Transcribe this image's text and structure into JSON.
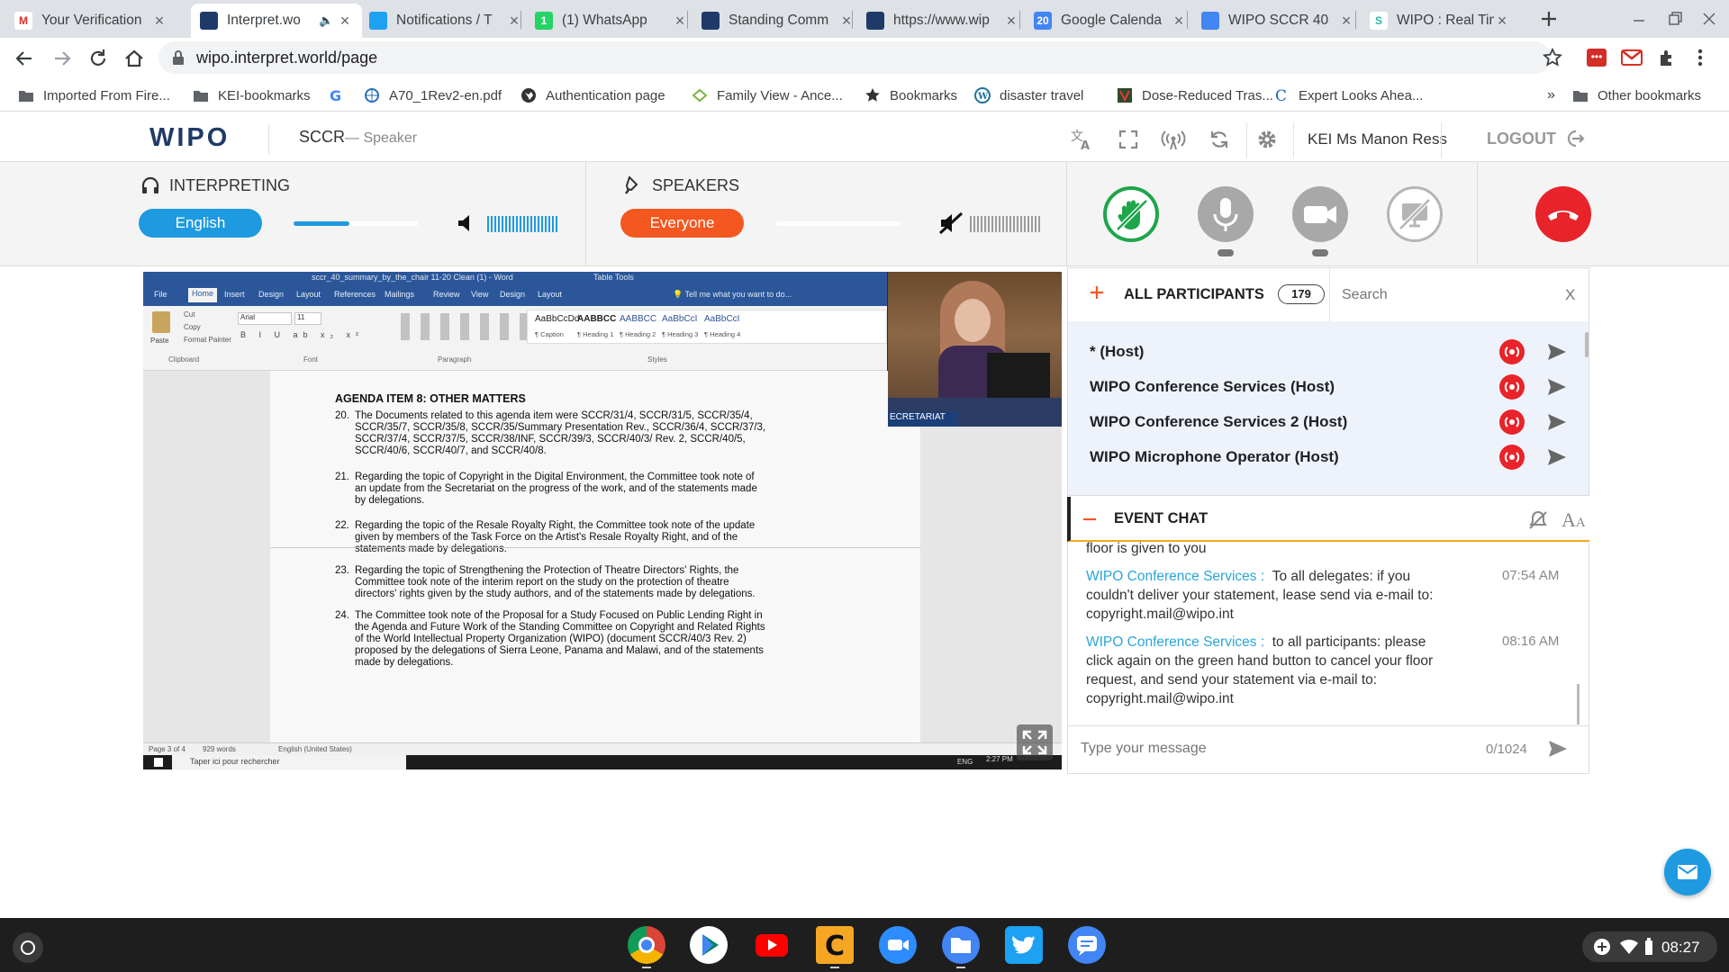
{
  "tabs": [
    {
      "title": "Your Verification",
      "fav_bg": "#ffffff",
      "fav_txt": "M",
      "fav_color": "#d93025",
      "active": false
    },
    {
      "title": "Interpret.wo",
      "fav_bg": "#1f3a68",
      "fav_txt": "",
      "fav_color": "#fff",
      "active": true
    },
    {
      "title": "Notifications / T",
      "fav_bg": "#1da1f2",
      "fav_txt": "",
      "fav_color": "#fff",
      "active": false
    },
    {
      "title": "(1) WhatsApp",
      "fav_bg": "#25d366",
      "fav_txt": "1",
      "fav_color": "#fff",
      "active": false
    },
    {
      "title": "Standing Comm",
      "fav_bg": "#1f3a68",
      "fav_txt": "",
      "fav_color": "#fff",
      "active": false
    },
    {
      "title": "https://www.wip",
      "fav_bg": "#1f3a68",
      "fav_txt": "",
      "fav_color": "#fff",
      "active": false
    },
    {
      "title": "Google Calenda",
      "fav_bg": "#4285f4",
      "fav_txt": "20",
      "fav_color": "#fff",
      "active": false
    },
    {
      "title": "WIPO SCCR 40",
      "fav_bg": "#4285f4",
      "fav_txt": "",
      "fav_color": "#fff",
      "active": false
    },
    {
      "title": "WIPO : Real Tim",
      "fav_bg": "#ffffff",
      "fav_txt": "S",
      "fav_color": "#2ab5a0",
      "active": false
    }
  ],
  "url": "wipo.interpret.world/page",
  "bookmarks": [
    {
      "label": "Imported From Fire...",
      "icon": "folder-icon"
    },
    {
      "label": "KEI-bookmarks",
      "icon": "folder-icon"
    },
    {
      "label": "",
      "icon": "google-icon"
    },
    {
      "label": "A70_1Rev2-en.pdf",
      "icon": "un-icon"
    },
    {
      "label": "Authentication page",
      "icon": "globe-icon"
    },
    {
      "label": "Family View - Ance...",
      "icon": "leaf-icon"
    },
    {
      "label": "Bookmarks",
      "icon": "star-icon"
    },
    {
      "label": "disaster travel",
      "icon": "wordpress-icon"
    },
    {
      "label": "Dose-Reduced Tras...",
      "icon": "journal-icon"
    },
    {
      "label": "Expert Looks Ahea...",
      "icon": "c-icon"
    }
  ],
  "other_bookmarks": "Other bookmarks",
  "more_bookmarks": "»",
  "app": {
    "logo": "WIPO",
    "session": "SCCR",
    "role": "— Speaker",
    "user": "KEI Ms Manon Ress",
    "logout": "LOGOUT"
  },
  "interpreting": {
    "label": "INTERPRETING",
    "language": "English",
    "slider": 0.45,
    "volume": 1.0
  },
  "speakers": {
    "label": "SPEAKERS",
    "filter": "Everyone",
    "slider": 0.0,
    "volume": 0.0
  },
  "colors": {
    "accent_blue": "#1e9ae0",
    "accent_orange": "#f4571f",
    "hand_green": "#1ea64a",
    "hangup_red": "#e8242a",
    "chat_name": "#2aa5d8"
  },
  "video": {
    "word_title": "sccr_40_summary_by_the_chair 11-20 Clean (1) - Word",
    "table_tools": "Table Tools",
    "menu": [
      "File",
      "Home",
      "Insert",
      "Design",
      "Layout",
      "References",
      "Mailings",
      "Review",
      "View",
      "Design",
      "Layout"
    ],
    "tell_me": "Tell me what you want to do...",
    "clip": [
      "Cut",
      "Copy",
      "Format Painter"
    ],
    "paste": "Paste",
    "font_name": "Arial",
    "font_size": "11",
    "styles": [
      "AaBbCcDd",
      "AABBCC",
      "AABBCC",
      "AaBbCcI",
      "AaBbCcI"
    ],
    "style_names": [
      "¶ Caption",
      "¶ Heading 1",
      "¶ Heading 2",
      "¶ Heading 3",
      "¶ Heading 4"
    ],
    "groups": [
      "Clipboard",
      "Font",
      "Paragraph",
      "Styles"
    ],
    "heading": "AGENDA ITEM 8:  OTHER MATTERS",
    "items": [
      {
        "n": "20.",
        "t": "The Documents related to this agenda item were SCCR/31/4, SCCR/31/5, SCCR/35/4, SCCR/35/7, SCCR/35/8, SCCR/35/Summary Presentation Rev., SCCR/36/4, SCCR/37/3, SCCR/37/4, SCCR/37/5, SCCR/38/INF, SCCR/39/3, SCCR/40/3/ Rev. 2, SCCR/40/5, SCCR/40/6, SCCR/40/7, and SCCR/40/8."
      },
      {
        "n": "21.",
        "t": "Regarding the topic of Copyright in the Digital Environment, the Committee took note of an update from the Secretariat on the progress of the work, and of the statements made by delegations."
      },
      {
        "n": "22.",
        "t": "Regarding the topic of the Resale Royalty Right, the Committee took note of the update given by members of the Task Force on the Artist's Resale Royalty Right, and of the statements made by delegations."
      },
      {
        "n": "23.",
        "t": "Regarding the topic of Strengthening the Protection of Theatre Directors' Rights, the Committee took note of the interim report on the study on the protection of theatre directors' rights given by the study authors, and of the statements made by delegations."
      },
      {
        "n": "24.",
        "t": "The Committee took note of the Proposal for a Study Focused on Public Lending Right in the Agenda and Future Work of the Standing Committee on Copyright and Related Rights of the World Intellectual Property Organization (WIPO) (document SCCR/40/3 Rev. 2) proposed by the delegations of Sierra Leone, Panama and Malawi, and of the statements made by delegations."
      }
    ],
    "status_page": "Page 3 of 4",
    "status_words": "929 words",
    "status_lang": "English (United States)",
    "win_search": "Taper ici pour rechercher",
    "win_lang": "ENG",
    "win_time": "2:27 PM",
    "win_date": "11/20/2020",
    "secretariat": "ECRETARIAT"
  },
  "participants": {
    "title": "ALL PARTICIPANTS",
    "count": "179",
    "search_placeholder": "Search",
    "close": "X",
    "list": [
      {
        "name": "* (Host)"
      },
      {
        "name": "WIPO Conference Services (Host)"
      },
      {
        "name": "WIPO Conference Services 2 (Host)"
      },
      {
        "name": "WIPO Microphone Operator (Host)"
      }
    ]
  },
  "chat": {
    "title": "EVENT CHAT",
    "partial": "floor is given to you",
    "messages": [
      {
        "sender": "WIPO Conference Services :",
        "text": "To all delegates: if you couldn't deliver your statement, lease send via e-mail to: copyright.mail@wipo.int",
        "time": "07:54 AM"
      },
      {
        "sender": "WIPO Conference Services :",
        "text": "to all participants: please click again on the green hand button to cancel your floor request, and send your statement via e-mail to: copyright.mail@wipo.int",
        "time": "08:16 AM"
      }
    ],
    "input_placeholder": "Type your message",
    "counter": "0/1024"
  },
  "shelf": {
    "time": "08:27"
  }
}
